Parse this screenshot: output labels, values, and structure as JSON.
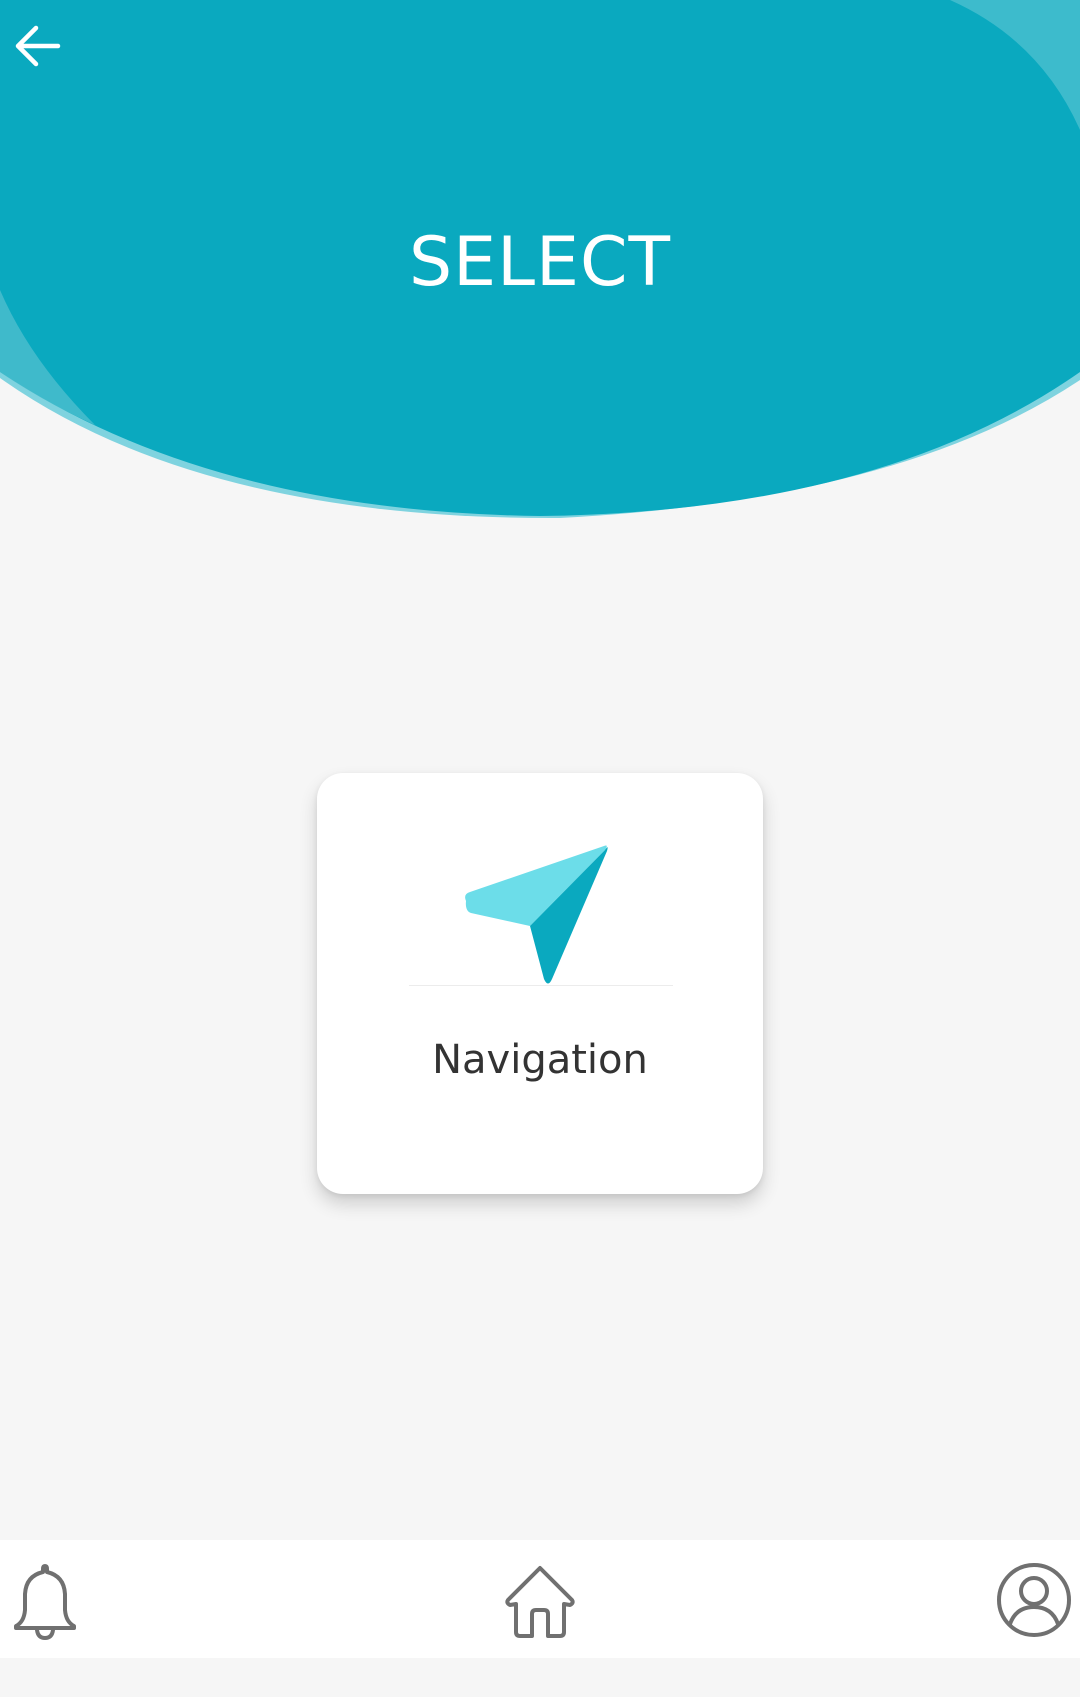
{
  "header": {
    "title": "SELECT",
    "back_icon": "arrow-left-icon",
    "color": "#0aa9bf"
  },
  "main": {
    "cards": [
      {
        "label": "Navigation",
        "icon": "navigation-arrow-icon"
      }
    ]
  },
  "bottom_nav": {
    "items": [
      {
        "icon": "bell-icon"
      },
      {
        "icon": "home-icon"
      },
      {
        "icon": "user-profile-icon"
      }
    ]
  },
  "colors": {
    "accent": "#0aa9bf",
    "accent_light": "#6cdde9",
    "background": "#f6f6f6",
    "icon_gray": "#707070"
  }
}
